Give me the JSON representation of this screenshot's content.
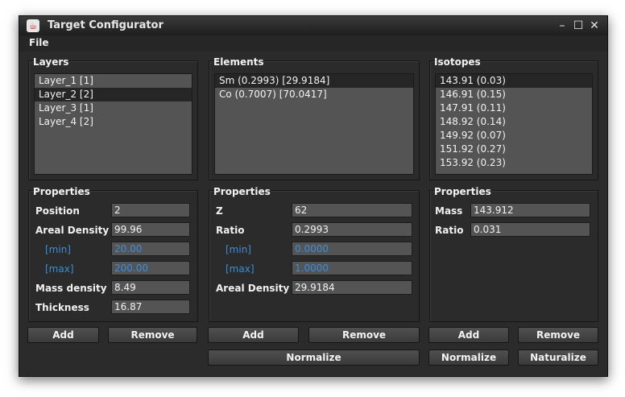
{
  "window": {
    "title": "Target Configurator",
    "icon": "java-cup-icon"
  },
  "menu": {
    "file": "File"
  },
  "layers": {
    "title": "Layers",
    "items": [
      "Layer_1 [1]",
      "Layer_2 [2]",
      "Layer_3 [1]",
      "Layer_4 [2]"
    ],
    "selected_index": 1
  },
  "elements": {
    "title": "Elements",
    "items": [
      "Sm (0.2993) [29.9184]",
      "Co (0.7007) [70.0417]"
    ],
    "selected_index": 0
  },
  "isotopes": {
    "title": "Isotopes",
    "items": [
      "143.91 (0.03)",
      "146.91 (0.15)",
      "147.91 (0.11)",
      "148.92 (0.14)",
      "149.92 (0.07)",
      "151.92 (0.27)",
      "153.92 (0.23)"
    ],
    "selected_index": 0
  },
  "layer_props": {
    "title": "Properties",
    "position_label": "Position",
    "position": "2",
    "areal_density_label": "Areal Density",
    "areal_density": "99.96",
    "min_label": "[min]",
    "min": "20.00",
    "max_label": "[max]",
    "max": "200.00",
    "mass_density_label": "Mass density",
    "mass_density": "8.49",
    "thickness_label": "Thickness",
    "thickness": "16.87"
  },
  "element_props": {
    "title": "Properties",
    "z_label": "Z",
    "z": "62",
    "ratio_label": "Ratio",
    "ratio": "0.2993",
    "min_label": "[min]",
    "min": "0.0000",
    "max_label": "[max]",
    "max": "1.0000",
    "areal_density_label": "Areal Density",
    "areal_density": "29.9184"
  },
  "isotope_props": {
    "title": "Properties",
    "mass_label": "Mass",
    "mass": "143.912",
    "ratio_label": "Ratio",
    "ratio": "0.031"
  },
  "buttons": {
    "add": "Add",
    "remove": "Remove",
    "normalize": "Normalize",
    "naturalize": "Naturalize"
  },
  "colors": {
    "window_bg": "#2b2b2b",
    "field_bg": "#545454",
    "selection": "#262626",
    "accent_blue": "#3a8fdc"
  }
}
